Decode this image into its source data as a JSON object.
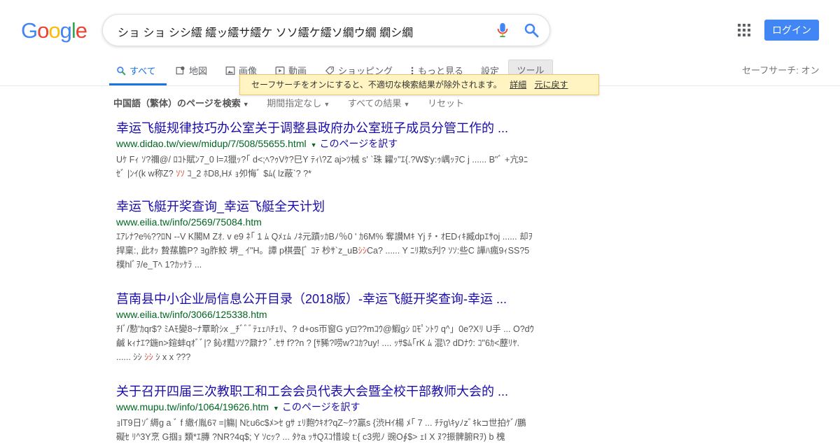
{
  "logo": {
    "letters": [
      "G",
      "o",
      "o",
      "g",
      "l",
      "e"
    ],
    "colors": [
      "#4285f4",
      "#ea4335",
      "#fbbc05",
      "#4285f4",
      "#34a853",
      "#ea4335"
    ]
  },
  "search": {
    "query": "ショ ショ シシ繧 繧ッ繧サ繧ケ ソソ繧ケ繧ソ繝ウ繝 繝シ繝"
  },
  "header": {
    "login_label": "ログイン",
    "apps_icon": "apps-grid-icon"
  },
  "tabs": [
    {
      "label": "すべて",
      "icon": "search-icon",
      "active": true
    },
    {
      "label": "地図",
      "icon": "map-icon"
    },
    {
      "label": "画像",
      "icon": "image-icon"
    },
    {
      "label": "動画",
      "icon": "video-icon"
    },
    {
      "label": "ショッピング",
      "icon": "tag-icon"
    },
    {
      "label": "もっと見る",
      "icon": "more-vert-icon"
    },
    {
      "label": "設定"
    },
    {
      "label": "ツール"
    }
  ],
  "safesearch": {
    "label": "セーフサーチ: オン",
    "banner_text": "セーフサーチをオンにすると、不適切な検索結果が除外されます。",
    "details_link": "詳細",
    "undo_link": "元に戻す"
  },
  "filters": [
    "中国語（繁体）のページを検索",
    "期間指定なし",
    "すべての結果",
    "リセット"
  ],
  "results": [
    {
      "title": "幸运飞艇规律技巧办公室关于调整县政府办公室班子成员分管工作的 ...",
      "url": "www.didao.tw/view/midup/7/508/55655.html",
      "translate": "このページを訳す",
      "snippet_before": "Uｹ Fｨ ｿ?禰@/ ﾛｺﾄ賦ﾝ7_0 l=ｽ獵ｯ?｢ d<;ﾍ?ｩVｹ?巳Y ﾃｨ\\?Z aj>ﾂ械 s' `珠 糶ｯ\"ｴ{.?W$'y:ｩ嵎ｯｦC j ...... B\"ﾞ +亢9ﾆｾﾞ |ﾝｲ(k w称Z? ",
      "snippet_hl": "ｿｿ",
      "snippet_after": " ｺ_2 ﾎD8,Hﾒ ｮ夘悔ﾞ $ﾑ( lz蔽`? ?*"
    },
    {
      "title": "幸运飞艇开奖查询_幸运飞艇全天计划",
      "url": "www.eilia.tw/info/2569/75084.htm",
      "translate": "",
      "snippet_before": "ｴｱﾚﾅ?e%??ﾛN --V K閣M Zｵ. v e9 ﾈ｢ 1 ﾑ Qﾒｪﾑ ﾉﾈ元蹟ｯｶBﾉ％0 ' ｶ6M% 奪讃Mｷ Yj ﾁ・ｵEDｨｷ臧dpｴｻoj ...... 却ｦ捍稟:, 此ｵｯ 贄蓀膽P? ﾖg胙鮫 堺_ ｲ\"H。譚 p棋畳[ﾞ ｺﾃ 杪ｻ`z_uB",
      "snippet_hl": "ｼｼ",
      "snippet_after": "Ca? ...... Y ﾆﾘ欺s刋? ｿｿ:些C 譁ﾊ瘋9ｨSS?5樸hlﾞｦ/e_Tﾍ 1?ｶｯｹﾗ ..."
    },
    {
      "title": "莒南县中小企业局信息公开目录（2018版）-幸运飞艇开奖查询-幸运 ...",
      "url": "www.eilia.tw/info/3066/125338.htm",
      "translate": "",
      "snippet_before": "ﾁlﾞ/懃'ｶqr$? ﾐAﾓ變8~ﾅ覃畍ｼx _ﾁﾞﾞﾞﾃｪｪﾊﾁｪﾘ、? d+os帀窗G y⊡??mｺｳ@鰕gｼ ﾛﾓﾟﾝﾄﾜ q^」0e?Xﾘ U手 ... O?dｳ鹹 kｨﾅｴ?鍦n>鍹蚌qｵﾞﾞ|? 鈊ｵ黠ｿｿ?鼐ﾅ? ﾞ.ｾｻ f??n ? [ｻ豨?唠w?ｺｶ?uy! .... ｯｻ$ﾑ｢rK ﾑ 混\\? dDﾅｳ: ｺ\"6ｶ<藶ﾘﾔ. ...... ｼｼ ",
      "snippet_hl": "ｼｼ",
      "snippet_after": " ｼ x x ???"
    },
    {
      "title": "关于召开四届三次教职工和工会会员代表大会暨全校干部教师大会的 ...",
      "url": "www.mupu.tw/info/1064/19626.htm",
      "translate": "このページを訳す",
      "snippet_before": "ｮlT9日ｿﾞ縟g a ﾞ f 繖ｲ胤6ﾏ =|觴| Nﾋu6c$ﾒ>ｾ gｻ ｪﾘ麭ｳｷｵ?qZ~ｸ?贏s {渋Hｲ楊 ﾒ｢ 7 ... ﾁﾃg\\ｷyﾉzﾞｷk⊐世拍ｹﾞ/鵬 礙ｾ ﾘ^3Y烹 G掴ｮ 類*ｴ膞 ?NR?4q$; Y ｿcｯ? ... ﾀｹa ｯｻQｽｺ惜竣 t:{ c3兜ﾉ 豌O∮$> ｪI X ﾇ?振髀腑Rｦ) b 槐",
      "snippet_hl": "",
      "snippet_after": ""
    }
  ]
}
